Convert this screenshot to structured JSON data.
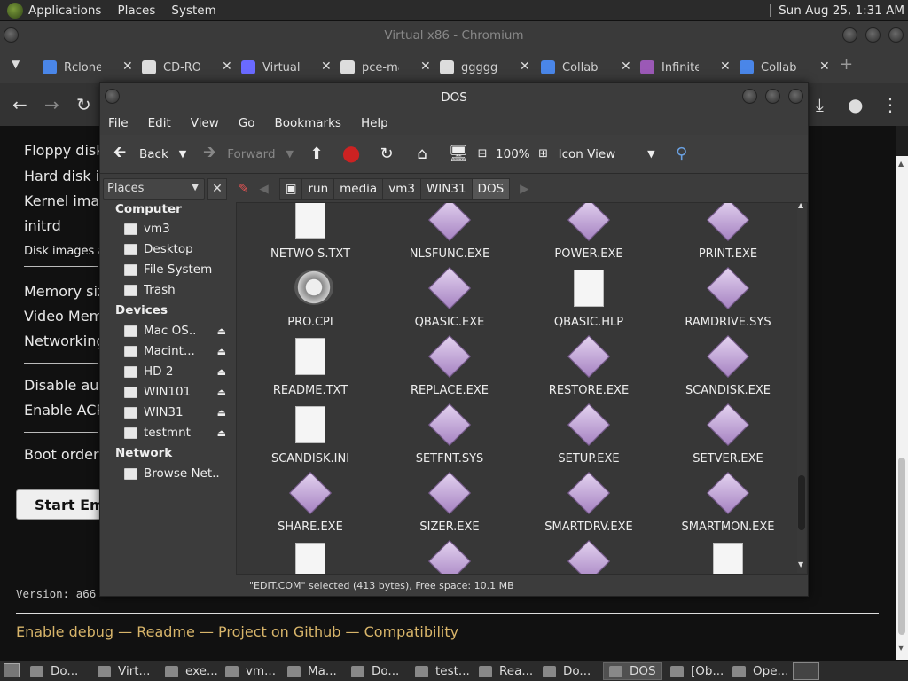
{
  "top_panel": {
    "menus": [
      "Applications",
      "Places",
      "System"
    ],
    "clock": "Sun Aug 25,  1:31 AM"
  },
  "chrome": {
    "title": "Virtual x86 - Chromium",
    "tabs": [
      {
        "label": "Rclone",
        "icon": "rclone-icon",
        "color": "#4a86e8"
      },
      {
        "label": "CD-RO",
        "icon": "document-icon",
        "color": "#dddddd"
      },
      {
        "label": "Virtual",
        "icon": "virtual-icon",
        "color": "#6a6aff"
      },
      {
        "label": "pce-ma",
        "icon": "github-icon",
        "color": "#dddddd"
      },
      {
        "label": "gggggc",
        "icon": "document-icon",
        "color": "#dddddd"
      },
      {
        "label": "Collab",
        "icon": "search-icon",
        "color": "#4a86e8"
      },
      {
        "label": "Infinite",
        "icon": "rainbow-icon",
        "color": "#9b59b6"
      },
      {
        "label": "Collab",
        "icon": "search-icon",
        "color": "#4a86e8"
      }
    ]
  },
  "webpage": {
    "lines": [
      {
        "text": "Floppy disk"
      },
      {
        "text": "Hard disk im"
      },
      {
        "text": "Kernel imag"
      },
      {
        "text": "initrd"
      },
      {
        "text": "Disk images a"
      },
      {
        "text": "Memory size"
      },
      {
        "text": "Video Memo"
      },
      {
        "text": "Networking"
      },
      {
        "text": "Disable aud"
      },
      {
        "text": "Enable ACP"
      },
      {
        "text": "Boot order"
      }
    ],
    "start_button": "Start Emu",
    "version": "Version: a66",
    "links": [
      "Enable debug",
      "Readme",
      "Project on Github",
      "Compatibility"
    ],
    "link_separator": " — "
  },
  "filemanager": {
    "title": "DOS",
    "menu": [
      "File",
      "Edit",
      "View",
      "Go",
      "Bookmarks",
      "Help"
    ],
    "toolbar": {
      "back": "Back",
      "forward": "Forward",
      "zoom": "100%",
      "view_mode": "Icon View"
    },
    "places_label": "Places",
    "breadcrumbs": [
      "run",
      "media",
      "vm3",
      "WIN31",
      "DOS"
    ],
    "sidebar": {
      "computer_heading": "Computer",
      "computer_items": [
        "vm3",
        "Desktop",
        "File System",
        "Trash"
      ],
      "devices_heading": "Devices",
      "devices": [
        "Mac OS...",
        "Macint...",
        "HD 2",
        "WIN101",
        "WIN31",
        "testmnt"
      ],
      "network_heading": "Network",
      "network_items": [
        "Browse Net..."
      ]
    },
    "files": [
      {
        "name": "NETWO  S.TXT",
        "type": "doc"
      },
      {
        "name": "NLSFUNC.EXE",
        "type": "exe"
      },
      {
        "name": "POWER.EXE",
        "type": "exe"
      },
      {
        "name": "PRINT.EXE",
        "type": "exe"
      },
      {
        "name": "PRO.CPI",
        "type": "film"
      },
      {
        "name": "QBASIC.EXE",
        "type": "exe"
      },
      {
        "name": "QBASIC.HLP",
        "type": "doc"
      },
      {
        "name": "RAMDRIVE.SYS",
        "type": "exe"
      },
      {
        "name": "README.TXT",
        "type": "doc"
      },
      {
        "name": "REPLACE.EXE",
        "type": "exe"
      },
      {
        "name": "RESTORE.EXE",
        "type": "exe"
      },
      {
        "name": "SCANDISK.EXE",
        "type": "exe"
      },
      {
        "name": "SCANDISK.INI",
        "type": "doc"
      },
      {
        "name": "SETFNT.SYS",
        "type": "exe"
      },
      {
        "name": "SETUP.EXE",
        "type": "exe"
      },
      {
        "name": "SETVER.EXE",
        "type": "exe"
      },
      {
        "name": "SHARE.EXE",
        "type": "exe"
      },
      {
        "name": "SIZER.EXE",
        "type": "exe"
      },
      {
        "name": "SMARTDRV.EXE",
        "type": "exe"
      },
      {
        "name": "SMARTMON.EXE",
        "type": "exe"
      }
    ],
    "status": "\"EDIT.COM\" selected (413 bytes), Free space: 10.1 MB"
  },
  "taskbar": {
    "items": [
      {
        "label": "Do...",
        "active": false
      },
      {
        "label": "Virt...",
        "active": false
      },
      {
        "label": "exe...",
        "active": false
      },
      {
        "label": "vm...",
        "active": false
      },
      {
        "label": "Ma...",
        "active": false
      },
      {
        "label": "Do...",
        "active": false
      },
      {
        "label": "test...",
        "active": false
      },
      {
        "label": "Rea...",
        "active": false
      },
      {
        "label": "Do...",
        "active": false
      },
      {
        "label": "DOS",
        "active": true
      },
      {
        "label": "[Ob...",
        "active": false
      },
      {
        "label": "Ope...",
        "active": false
      }
    ]
  }
}
